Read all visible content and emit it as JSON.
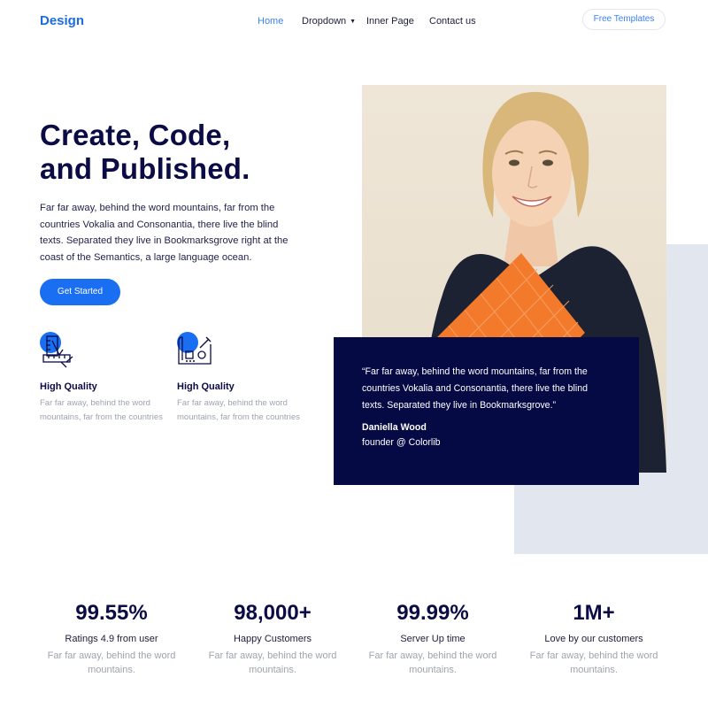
{
  "header": {
    "brand": "Design",
    "nav": [
      {
        "label": "Home",
        "active": true
      },
      {
        "label": "Dropdown",
        "has_caret": true
      },
      {
        "label": "Inner Page"
      },
      {
        "label": "Contact us"
      }
    ],
    "cta_label": "Free Templates"
  },
  "hero": {
    "title_line1": "Create, Code,",
    "title_line2": "and Published.",
    "paragraph": "Far far away, behind the word mountains, far from the countries Vokalia and Consonantia, there live the blind texts. Separated they live in Bookmarksgrove right at the coast of the Semantics, a large language ocean.",
    "button_label": "Get Started"
  },
  "features": [
    {
      "icon": "ruler-pencil-icon",
      "title": "High Quality",
      "text": "Far far away, behind the word mountains, far from the countries"
    },
    {
      "icon": "blueprint-icon",
      "title": "High Quality",
      "text": "Far far away, behind the word mountains, far from the countries"
    }
  ],
  "testimonial": {
    "quote": "“Far far away, behind the word mountains, far from the countries Vokalia and Consonantia, there live the blind texts. Separated they live in Bookmarksgrove.”",
    "name": "Daniella Wood",
    "role": "founder @ Colorlib"
  },
  "stats": [
    {
      "value": "99.55%",
      "label": "Ratings 4.9 from user",
      "text": "Far far away, behind the word mountains."
    },
    {
      "value": "98,000+",
      "label": "Happy Customers",
      "text": "Far far away, behind the word mountains."
    },
    {
      "value": "99.99%",
      "label": "Server Up time",
      "text": "Far far away, behind the word mountains."
    },
    {
      "value": "1M+",
      "label": "Love by our customers",
      "text": "Far far away, behind the word mountains."
    }
  ],
  "colors": {
    "accent": "#1a6ef2",
    "navy": "#050a45",
    "muted": "#9ea3ae",
    "shape": "#e1e6ef"
  }
}
